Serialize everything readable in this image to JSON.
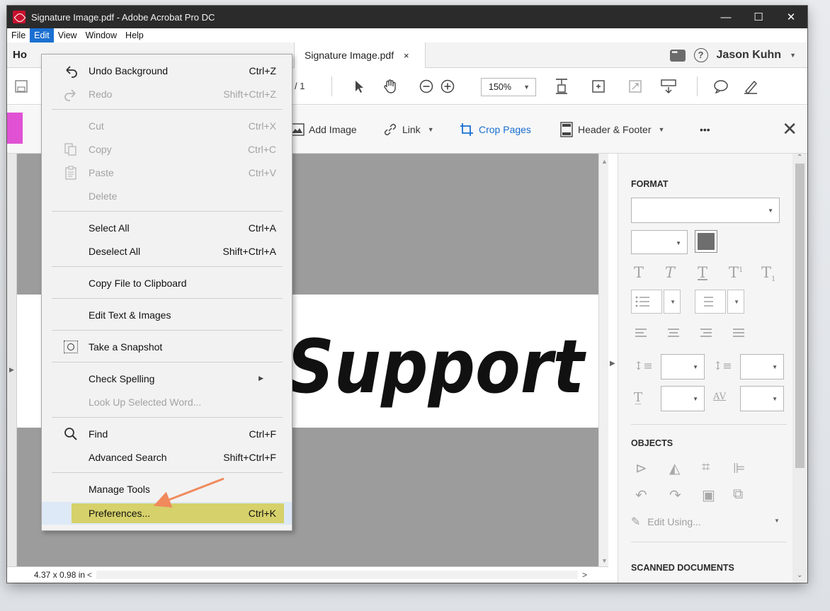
{
  "window": {
    "title": "Signature Image.pdf - Adobe Acrobat Pro DC",
    "controls": {
      "minimize": "—",
      "maximize": "☐",
      "close": "✕"
    }
  },
  "menubar": [
    "File",
    "Edit",
    "View",
    "Window",
    "Help"
  ],
  "tabs": {
    "home_partial": "Ho",
    "document": "Signature Image.pdf",
    "close_glyph": "×",
    "user": "Jason Kuhn",
    "help_glyph": "?"
  },
  "toolbar": {
    "page_total": "/ 1",
    "zoom": "150%"
  },
  "edit_toolbar": {
    "add_image": "Add Image",
    "link": "Link",
    "crop_pages": "Crop Pages",
    "header_footer": "Header & Footer",
    "more": "•••",
    "close": "✕"
  },
  "document": {
    "signature_text": "Support"
  },
  "statusbar": {
    "size": "4.37 x 0.98 in",
    "left_arrow": "<",
    "right_arrow": ">"
  },
  "right_panel": {
    "format_title": "FORMAT",
    "objects_title": "OBJECTS",
    "edit_using": "Edit Using...",
    "scanned_title": "SCANNED DOCUMENTS"
  },
  "edit_menu": {
    "items": [
      {
        "label": "Undo Background",
        "shortcut": "Ctrl+Z",
        "enabled": true,
        "icon": "undo-icon"
      },
      {
        "label": "Redo",
        "shortcut": "Shift+Ctrl+Z",
        "enabled": false,
        "icon": "redo-icon"
      },
      {
        "label": "Cut",
        "shortcut": "Ctrl+X",
        "enabled": false
      },
      {
        "label": "Copy",
        "shortcut": "Ctrl+C",
        "enabled": false,
        "icon": "copy-icon"
      },
      {
        "label": "Paste",
        "shortcut": "Ctrl+V",
        "enabled": false,
        "icon": "paste-icon"
      },
      {
        "label": "Delete",
        "shortcut": "",
        "enabled": false
      },
      {
        "label": "Select All",
        "shortcut": "Ctrl+A",
        "enabled": true
      },
      {
        "label": "Deselect All",
        "shortcut": "Shift+Ctrl+A",
        "enabled": true
      },
      {
        "label": "Copy File to Clipboard",
        "shortcut": "",
        "enabled": true
      },
      {
        "label": "Edit Text & Images",
        "shortcut": "",
        "enabled": true
      },
      {
        "label": "Take a Snapshot",
        "shortcut": "",
        "enabled": true,
        "icon": "camera-icon"
      },
      {
        "label": "Check Spelling",
        "shortcut": "",
        "enabled": true,
        "submenu": true
      },
      {
        "label": "Look Up Selected Word...",
        "shortcut": "",
        "enabled": false
      },
      {
        "label": "Find",
        "shortcut": "Ctrl+F",
        "enabled": true,
        "icon": "search-icon"
      },
      {
        "label": "Advanced Search",
        "shortcut": "Shift+Ctrl+F",
        "enabled": true
      },
      {
        "label": "Manage Tools",
        "shortcut": "",
        "enabled": true
      },
      {
        "label": "Preferences...",
        "shortcut": "Ctrl+K",
        "enabled": true,
        "highlighted": true
      }
    ]
  },
  "colors": {
    "titlebar": "#2b2b2b",
    "menu_active": "#1a6fd1",
    "accent_blue": "#1a6fd1",
    "edit_tab": "#e052d3",
    "highlight": "#d6d16a",
    "arrow": "#f08a5d"
  }
}
